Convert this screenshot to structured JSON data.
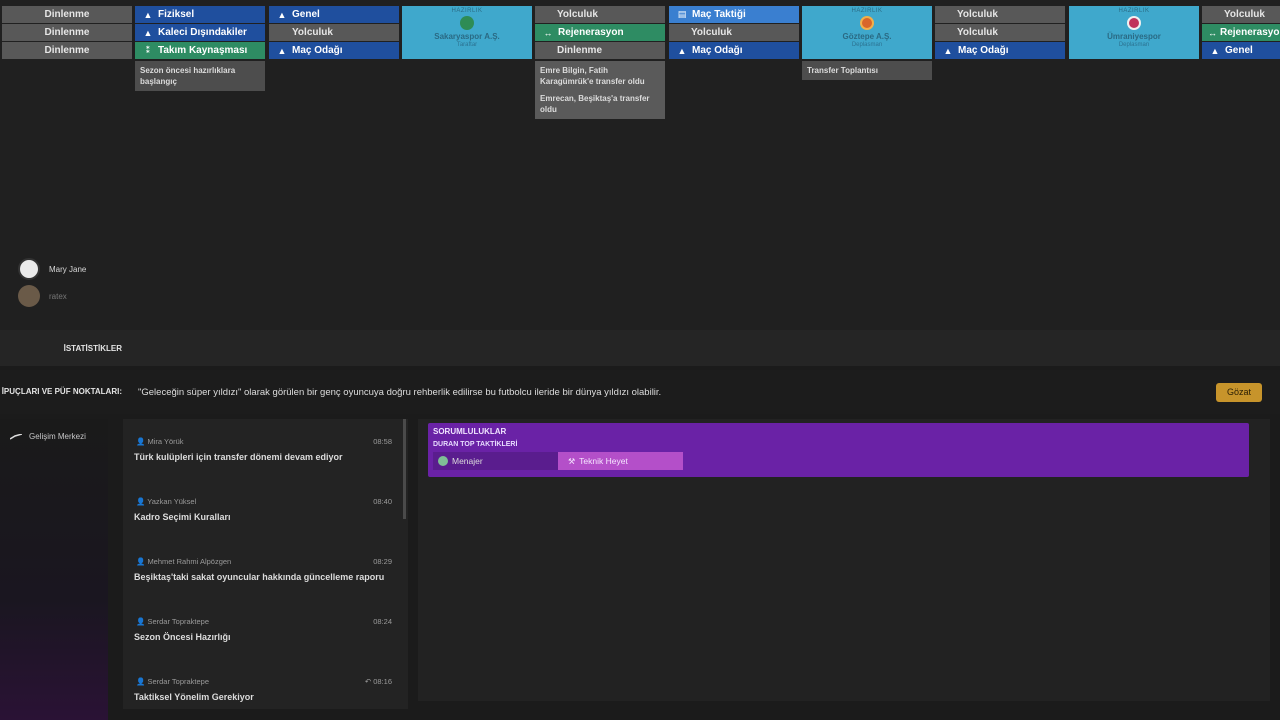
{
  "schedule": {
    "days": [
      {
        "slots": [
          {
            "label": "Dinlenme",
            "style": "gray"
          },
          {
            "label": "Dinlenme",
            "style": "gray"
          },
          {
            "label": "Dinlenme",
            "style": "gray"
          }
        ]
      },
      {
        "slots": [
          {
            "label": "Fiziksel",
            "style": "blue",
            "icon": "cone-icon"
          },
          {
            "label": "Kaleci Dışındakiler",
            "style": "blue",
            "icon": "cone-icon"
          },
          {
            "label": "Takım Kaynaşması",
            "style": "green",
            "icon": "team-icon"
          }
        ],
        "note": "Sezon öncesi hazırlıklara başlangıç"
      },
      {
        "slots": [
          {
            "label": "Genel",
            "style": "blue",
            "icon": "cone-icon"
          },
          {
            "label": "Yolculuk",
            "style": "gray"
          },
          {
            "label": "Maç Odağı",
            "style": "blue",
            "icon": "cone-icon"
          }
        ]
      },
      {
        "match": {
          "label": "HAZIRLIK",
          "team": "Sakaryaspor A.Ş.",
          "side": "Taraftar",
          "crest_color": "#2e8c55"
        }
      },
      {
        "slots": [
          {
            "label": "Yolculuk",
            "style": "gray"
          },
          {
            "label": "Rejenerasyon",
            "style": "green",
            "icon": "regen-icon"
          },
          {
            "label": "Dinlenme",
            "style": "gray"
          }
        ],
        "notes": [
          "Emre Bilgin, Fatih Karagümrük'e transfer oldu",
          "Emrecan, Beşiktaş'a transfer oldu"
        ]
      },
      {
        "slots": [
          {
            "label": "Maç Taktiği",
            "style": "blue",
            "icon": "clipboard-icon"
          },
          {
            "label": "Yolculuk",
            "style": "gray"
          },
          {
            "label": "Maç Odağı",
            "style": "blue",
            "icon": "cone-icon"
          }
        ]
      },
      {
        "match": {
          "label": "HAZIRLIK",
          "team": "Göztepe A.Ş.",
          "side": "Deplasman",
          "crest_color": "#d8662a"
        },
        "note": "Transfer Toplantısı"
      },
      {
        "slots": [
          {
            "label": "Yolculuk",
            "style": "gray"
          },
          {
            "label": "Yolculuk",
            "style": "gray"
          },
          {
            "label": "Maç Odağı",
            "style": "blue",
            "icon": "cone-icon"
          }
        ]
      },
      {
        "match": {
          "label": "HAZIRLIK",
          "team": "Ümraniyespor",
          "side": "Deplasman",
          "crest_color": "#c0335a"
        }
      },
      {
        "slots": [
          {
            "label": "Yolculuk",
            "style": "gray"
          },
          {
            "label": "Rejenerasyon",
            "style": "green",
            "icon": "regen-icon"
          },
          {
            "label": "Genel",
            "style": "blue",
            "icon": "cone-icon"
          }
        ]
      }
    ]
  },
  "managers": [
    {
      "name": "Mary Jane"
    },
    {
      "name": "ratex"
    }
  ],
  "stats": {
    "label": "İSTATİSTİKLER"
  },
  "tips": {
    "label": "İPUÇLARI VE PÜF NOKTALARI:",
    "text": "\"Geleceğin süper yıldızı\" olarak görülen bir genç oyuncuya doğru rehberlik edilirse bu futbolcu ileride bir dünya yıldızı olabilir.",
    "button": "Gözat"
  },
  "nav": {
    "item": "Gelişim Merkezi"
  },
  "news": [
    {
      "author": "Mira Yörük",
      "time": "08:58",
      "headline": "Türk kulüpleri için transfer dönemi devam ediyor"
    },
    {
      "author": "Yazkan Yüksel",
      "time": "08:40",
      "headline": "Kadro Seçimi Kuralları"
    },
    {
      "author": "Mehmet Rahmi Alpözgen",
      "time": "08:29",
      "headline": "Beşiktaş'taki sakat oyuncular hakkında güncelleme raporu"
    },
    {
      "author": "Serdar Topraktepe",
      "time": "08:24",
      "headline": "Sezon Öncesi Hazırlığı"
    },
    {
      "author": "Serdar Topraktepe",
      "time": "08:16",
      "headline": "Taktiksel Yönelim Gerekiyor"
    }
  ],
  "responsibilities": {
    "title": "SORUMLULUKLAR",
    "subtitle": "DURAN TOP TAKTİKLERİ",
    "choice_manager": "Menajer",
    "choice_staff": "Teknik Heyet"
  }
}
